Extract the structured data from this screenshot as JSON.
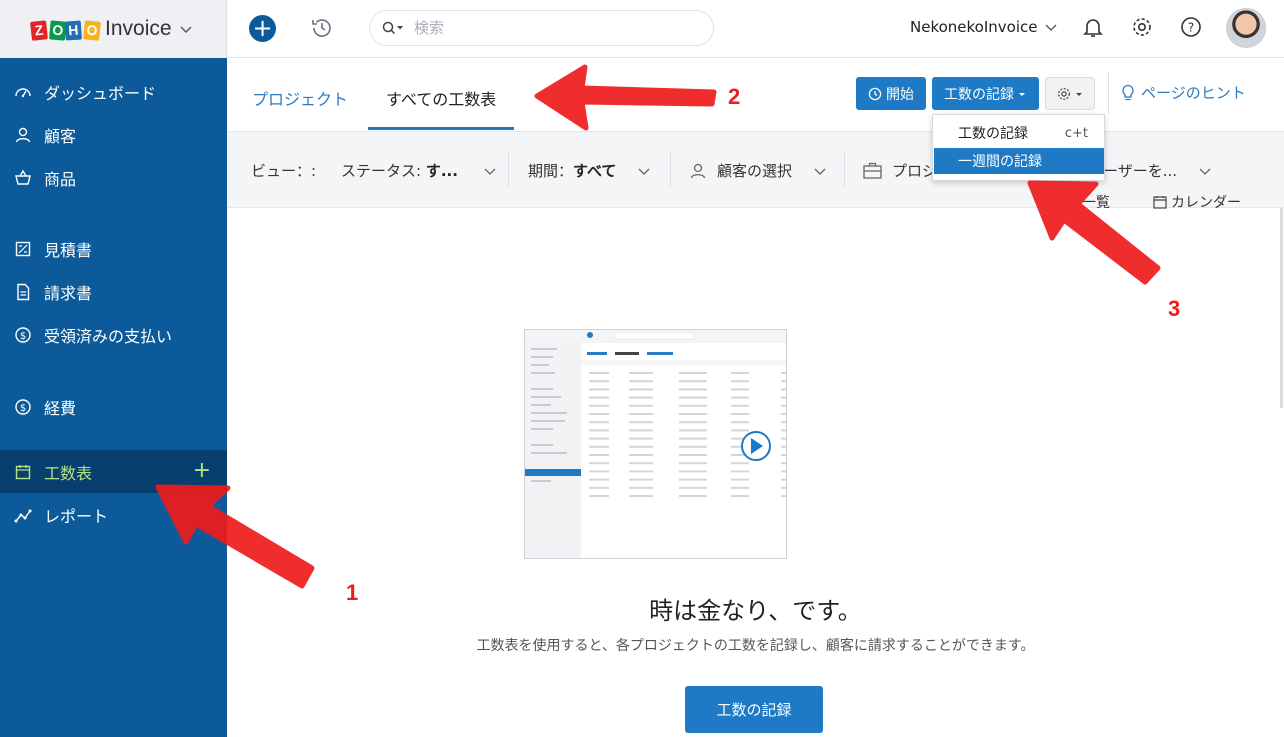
{
  "brand": {
    "logo_letters": [
      "Z",
      "O",
      "H",
      "O"
    ],
    "name": "Invoice"
  },
  "sidebar": {
    "items": [
      {
        "label": "ダッシュボード",
        "icon": "dashboard-icon"
      },
      {
        "label": "顧客",
        "icon": "user-icon"
      },
      {
        "label": "商品",
        "icon": "basket-icon"
      },
      {
        "label": "見積書",
        "icon": "estimate-icon"
      },
      {
        "label": "請求書",
        "icon": "invoice-icon"
      },
      {
        "label": "受領済みの支払い",
        "icon": "payment-icon"
      },
      {
        "label": "経費",
        "icon": "expense-icon"
      },
      {
        "label": "工数表",
        "icon": "timesheet-icon",
        "active": true,
        "add": "+"
      },
      {
        "label": "レポート",
        "icon": "report-icon"
      }
    ]
  },
  "topbar": {
    "search_placeholder": "検索",
    "org_name": "NekonekoInvoice"
  },
  "tabs": [
    {
      "label": "プロジェクト"
    },
    {
      "label": "すべての工数表",
      "active": true
    }
  ],
  "toolbar": {
    "start_label": "開始",
    "log_label": "工数の記録",
    "hint_label": "ページのヒント"
  },
  "dropdown": {
    "items": [
      {
        "label": "工数の記録",
        "shortcut": "c+t"
      },
      {
        "label": "一週間の記録",
        "highlighted": true
      }
    ]
  },
  "filters": {
    "view_label": "ビュー：:",
    "status_label": "ステータス:",
    "status_value": "す...",
    "period_label": "期間：",
    "period_value": "すべて",
    "customer_placeholder": "顧客の選択",
    "project_placeholder": "プロジ",
    "user_placeholder": "ーザーを...",
    "view_list": "一覧",
    "view_calendar": "カレンダー"
  },
  "empty_state": {
    "title": "時は金なり、です。",
    "description": "工数表を使用すると、各プロジェクトの工数を記録し、顧客に請求することができます。",
    "button_label": "工数の記録"
  },
  "annotations": [
    "1",
    "2",
    "3"
  ],
  "colors": {
    "sidebar": "#0d5a9a",
    "active_item": "#07406f",
    "accent": "#1f7ac5",
    "active_text": "#b5e383",
    "annotation": "#ee1c1c"
  }
}
